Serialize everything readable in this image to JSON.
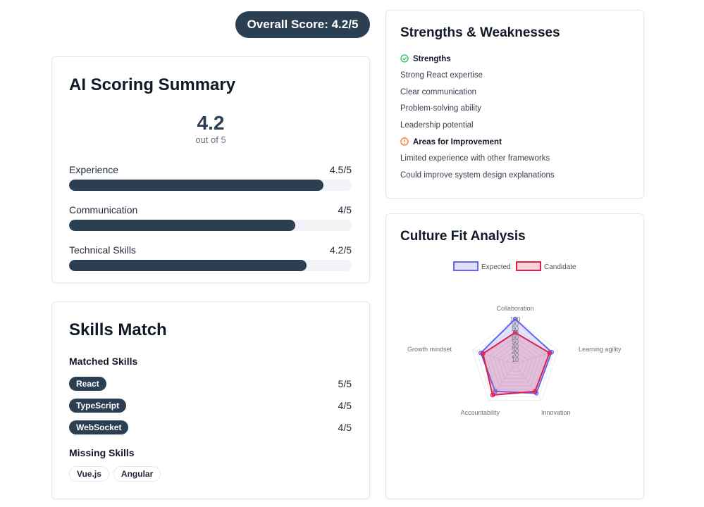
{
  "overall_score_label": "Overall Score: 4.2/5",
  "ai_summary": {
    "title": "AI Scoring Summary",
    "score": "4.2",
    "out_of": "out of 5",
    "bars": [
      {
        "label": "Experience",
        "value_text": "4.5/5",
        "fraction": 0.9
      },
      {
        "label": "Communication",
        "value_text": "4/5",
        "fraction": 0.8
      },
      {
        "label": "Technical Skills",
        "value_text": "4.2/5",
        "fraction": 0.84
      }
    ]
  },
  "skills_match": {
    "title": "Skills Match",
    "matched_title": "Matched Skills",
    "matched": [
      {
        "name": "React",
        "score": "5/5"
      },
      {
        "name": "TypeScript",
        "score": "4/5"
      },
      {
        "name": "WebSocket",
        "score": "4/5"
      }
    ],
    "missing_title": "Missing Skills",
    "missing": [
      "Vue.js",
      "Angular"
    ]
  },
  "strengths_weaknesses": {
    "title": "Strengths & Weaknesses",
    "strengths_title": "Strengths",
    "strengths": [
      "Strong React expertise",
      "Clear communication",
      "Problem-solving ability",
      "Leadership potential"
    ],
    "improvements_title": "Areas for Improvement",
    "improvements": [
      "Limited experience with other frameworks",
      "Could improve system design explanations"
    ],
    "colors": {
      "strength": "#22c55e",
      "improvement": "#f97316"
    }
  },
  "culture_fit": {
    "title": "Culture Fit Analysis",
    "chart_data": {
      "type": "radar",
      "categories": [
        "Collaboration",
        "Learning agility",
        "Innovation",
        "Accountability",
        "Growth mindset"
      ],
      "series": [
        {
          "name": "Expected",
          "values": [
            100,
            85,
            80,
            75,
            80
          ],
          "color": "#6366f1"
        },
        {
          "name": "Candidate",
          "values": [
            70,
            80,
            75,
            85,
            75
          ],
          "color": "#e11d48"
        }
      ],
      "ticks": [
        "10",
        "20",
        "30",
        "40",
        "50",
        "60",
        "70",
        "80",
        "90",
        "100"
      ],
      "rlim": [
        0,
        100
      ]
    }
  }
}
